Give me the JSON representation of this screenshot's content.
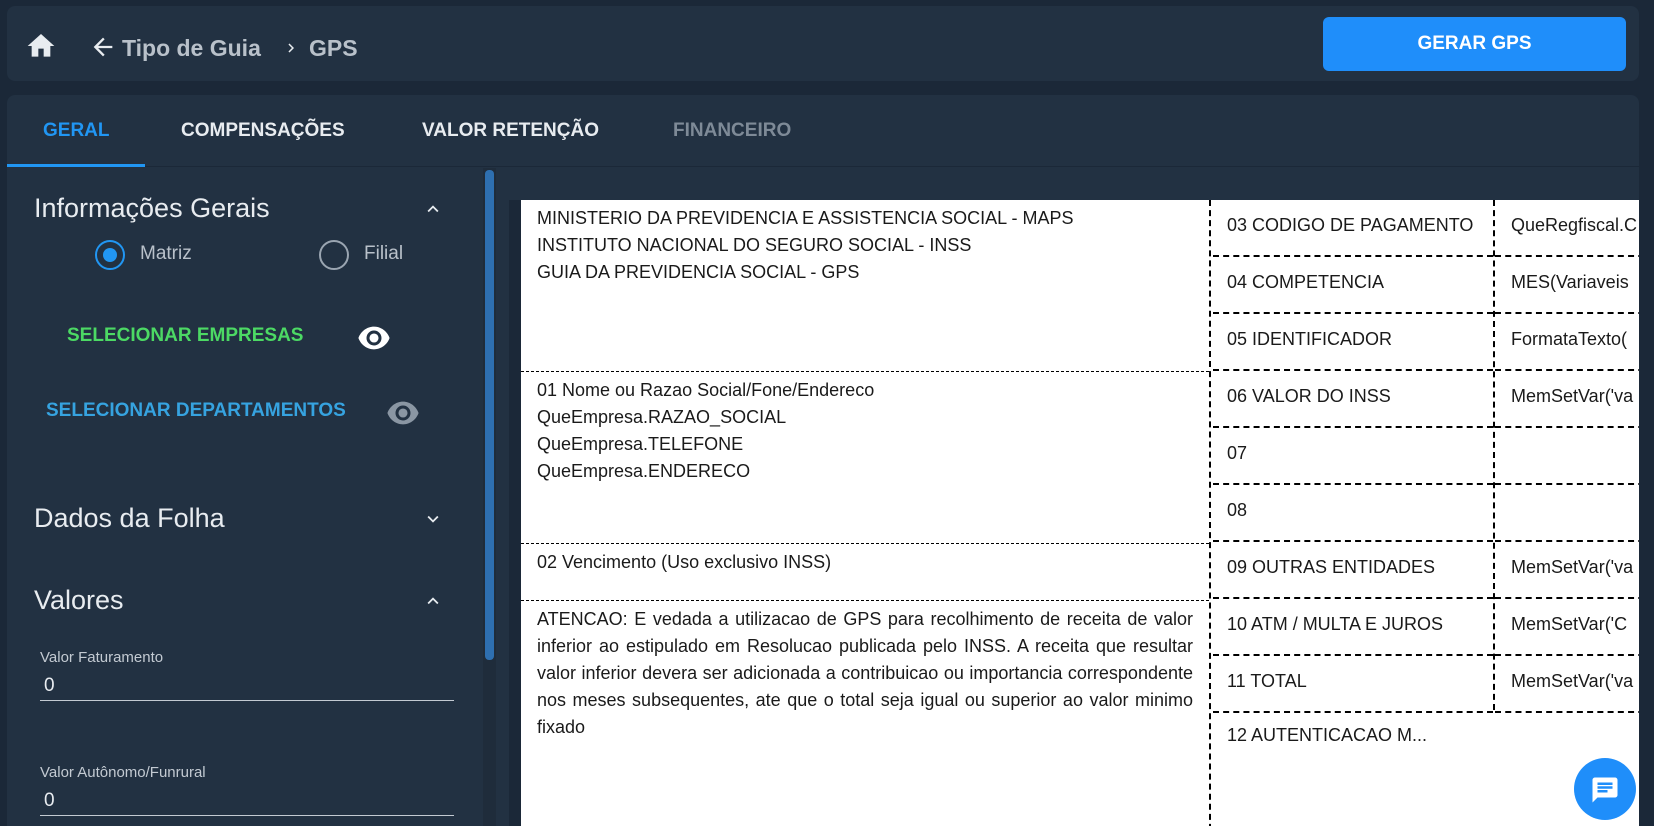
{
  "header": {
    "breadcrumb_parent": "Tipo de Guia",
    "breadcrumb_current": "GPS",
    "generate_button": "GERAR GPS"
  },
  "tabs": [
    {
      "label": "GERAL",
      "state": "active"
    },
    {
      "label": "COMPENSAÇÕES",
      "state": "normal"
    },
    {
      "label": "VALOR RETENÇÃO",
      "state": "normal"
    },
    {
      "label": "FINANCEIRO",
      "state": "disabled"
    }
  ],
  "sidebar": {
    "info_title": "Informações Gerais",
    "radio_matriz": "Matriz",
    "radio_filial": "Filial",
    "select_companies": "SELECIONAR EMPRESAS",
    "select_departments": "SELECIONAR DEPARTAMENTOS",
    "payroll_title": "Dados da Folha",
    "values_title": "Valores",
    "field_billing_label": "Valor Faturamento",
    "field_billing_value": "0",
    "field_autonomous_label": "Valor Autônomo/Funrural",
    "field_autonomous_value": "0"
  },
  "colors": {
    "accent": "#1f8efa",
    "green_action": "#4cd964",
    "blue_action": "#36a3e0"
  },
  "document": {
    "header_lines": [
      "MINISTERIO DA PREVIDENCIA E ASSISTENCIA SOCIAL - MAPS",
      "INSTITUTO NACIONAL DO SEGURO SOCIAL - INSS",
      "GUIA DA PREVIDENCIA SOCIAL - GPS"
    ],
    "company_lines": [
      "01 Nome ou Razao Social/Fone/Endereco",
      "QueEmpresa.RAZAO_SOCIAL",
      "QueEmpresa.TELEFONE",
      "QueEmpresa.ENDERECO"
    ],
    "due_date": "02 Vencimento (Uso exclusivo INSS)",
    "warning": "ATENCAO: E vedada a utilizacao de GPS para recolhimento de receita de valor inferior ao estipulado em Resolucao publicada pelo INSS. A receita que resultar valor inferior devera ser adicionada a contribuicao ou importancia correspondente nos meses subsequentes, ate que o total seja igual ou superior ao valor minimo fixado",
    "rows": [
      {
        "label": "03 CODIGO DE PAGAMENTO",
        "value": "QueRegfiscal.C"
      },
      {
        "label": "04 COMPETENCIA",
        "value": "MES(Variaveis"
      },
      {
        "label": "05 IDENTIFICADOR",
        "value": "FormataTexto("
      },
      {
        "label": "06 VALOR DO INSS",
        "value": "MemSetVar('va"
      },
      {
        "label": "07",
        "value": ""
      },
      {
        "label": "08",
        "value": ""
      },
      {
        "label": "09 OUTRAS ENTIDADES",
        "value": "MemSetVar('va"
      },
      {
        "label": "10 ATM / MULTA E JUROS",
        "value": "MemSetVar('C"
      },
      {
        "label": "11 TOTAL",
        "value": "MemSetVar('va"
      }
    ],
    "authentication": "12 AUTENTICACAO M..."
  }
}
